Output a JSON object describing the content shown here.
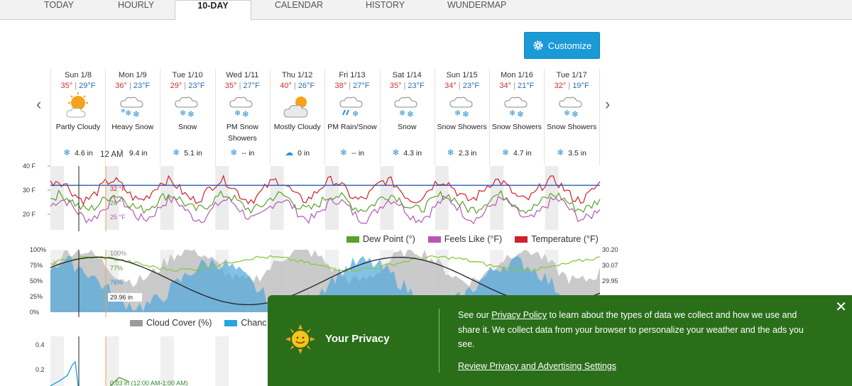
{
  "tabs": [
    "TODAY",
    "HOURLY",
    "10-DAY",
    "CALENDAR",
    "HISTORY",
    "WUNDERMAP"
  ],
  "active_tab": "10-DAY",
  "customize_label": "Customize",
  "days": [
    {
      "date": "Sun 1/8",
      "hi": "35°",
      "lo": "29°F",
      "icon": "partly-cloudy-icon",
      "cond": "Partly Cloudy",
      "precip": "4.6 in"
    },
    {
      "date": "Mon 1/9",
      "hi": "36°",
      "lo": "23°F",
      "icon": "heavy-snow-icon",
      "cond": "Heavy Snow",
      "precip": "9.4 in"
    },
    {
      "date": "Tue 1/10",
      "hi": "29°",
      "lo": "23°F",
      "icon": "snow-icon",
      "cond": "Snow",
      "precip": "5.1 in"
    },
    {
      "date": "Wed 1/11",
      "hi": "35°",
      "lo": "27°F",
      "icon": "snow-icon",
      "cond": "PM Snow Showers",
      "precip": "-- in"
    },
    {
      "date": "Thu 1/12",
      "hi": "40°",
      "lo": "26°F",
      "icon": "mostly-cloudy-icon",
      "cond": "Mostly Cloudy",
      "precip": "0 in"
    },
    {
      "date": "Fri 1/13",
      "hi": "38°",
      "lo": "27°F",
      "icon": "rain-snow-icon",
      "cond": "PM Rain/Snow",
      "precip": "-- in"
    },
    {
      "date": "Sat 1/14",
      "hi": "35°",
      "lo": "23°F",
      "icon": "snow-icon",
      "cond": "Snow",
      "precip": "4.3 in"
    },
    {
      "date": "Sun 1/15",
      "hi": "34°",
      "lo": "23°F",
      "icon": "snow-icon",
      "cond": "Snow Showers",
      "precip": "2.3 in"
    },
    {
      "date": "Mon 1/16",
      "hi": "34°",
      "lo": "21°F",
      "icon": "snow-icon",
      "cond": "Snow Showers",
      "precip": "4.7 in"
    },
    {
      "date": "Tue 1/17",
      "hi": "32°",
      "lo": "19°F",
      "icon": "snow-icon",
      "cond": "Snow Showers",
      "precip": "3.5 in"
    }
  ],
  "cursor_label": "12 AM",
  "temp_chart": {
    "y_ticks": [
      "40 F",
      "30 F",
      "20 F"
    ],
    "readouts": [
      "32 °F",
      "26 °",
      "25 °F"
    ],
    "legend": [
      "Dew Point (°)",
      "Feels Like (°F)",
      "Temperature (°F)"
    ],
    "colors": {
      "dew": "#5aa02c",
      "feels": "#b558b5",
      "temp": "#d0212d",
      "freeze": "#2a5db0"
    }
  },
  "cloud_chart": {
    "y_ticks": [
      "100%",
      "75%",
      "50%",
      "25%",
      "0%"
    ],
    "right_ticks": [
      "30.20",
      "30.07",
      "29.95"
    ],
    "readouts": [
      "100%",
      "77%",
      "76%",
      "29.96 in"
    ],
    "legend": [
      "Cloud Cover (%)",
      "Chanc"
    ]
  },
  "precip_chart": {
    "y_ticks": [
      "0.4",
      "0.2"
    ],
    "readout": "0.03 in (12:00 AM-1:00 AM)"
  },
  "privacy": {
    "title": "Your Privacy",
    "text_pre": "See our ",
    "link": "Privacy Policy",
    "text_post": " to learn about the types of data we collect and how we use and share it. We collect data from your browser to personalize your weather and the ads you see.",
    "settings": "Review Privacy and Advertising Settings"
  }
}
